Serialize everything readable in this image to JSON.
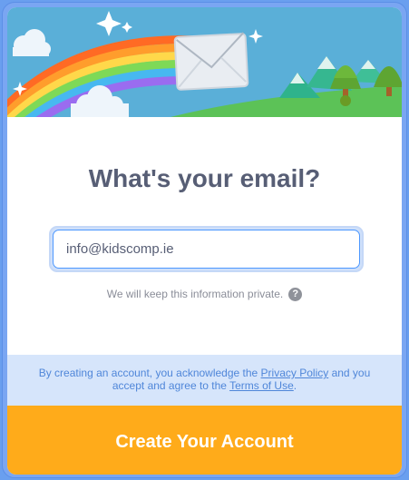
{
  "dialog": {
    "heading": "What's your email?",
    "email_value": "info@kidscomp.ie",
    "privacy_note": "We will keep this information private.",
    "help_glyph": "?",
    "legal": {
      "text_before": "By creating an account, you acknowledge the ",
      "privacy_link": "Privacy Policy",
      "text_middle": " and you accept and agree to the ",
      "terms_link": "Terms of Use",
      "text_after": "."
    },
    "create_button": "Create Your Account"
  },
  "colors": {
    "heading": "#575e75",
    "button": "#ffab1a",
    "legal_bg": "#d6e5fb",
    "link": "#4f86d9",
    "frame": "#7aa6f2"
  },
  "icons": [
    "envelope-icon",
    "help-icon",
    "sparkle-icon"
  ]
}
